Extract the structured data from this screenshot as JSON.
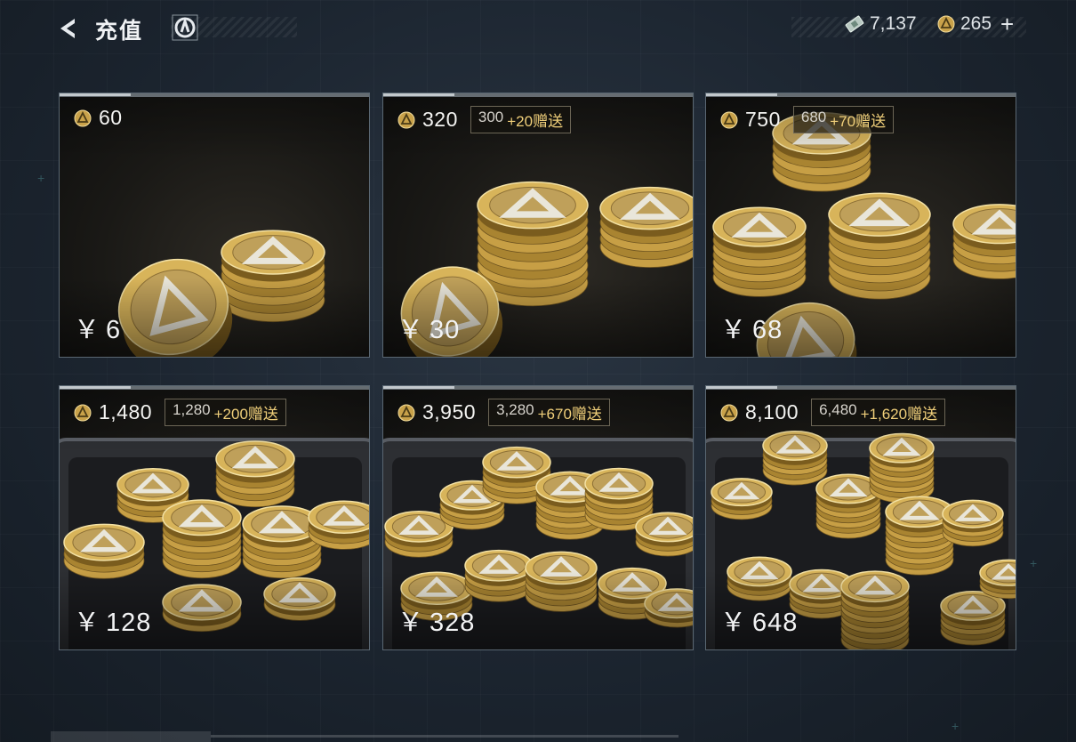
{
  "header": {
    "title": "充值",
    "back_icon": "back-arrow-icon",
    "logo_icon": "game-logo-icon"
  },
  "currency": {
    "ticket_amount": "7,137",
    "coin_amount": "265",
    "add_label": "+"
  },
  "products": [
    {
      "amount": "60",
      "base": "",
      "bonus": "",
      "price": "6",
      "art": "small"
    },
    {
      "amount": "320",
      "base": "300",
      "bonus": "+20赠送",
      "price": "30",
      "art": "small"
    },
    {
      "amount": "750",
      "base": "680",
      "bonus": "+70赠送",
      "price": "68",
      "art": "medium"
    },
    {
      "amount": "1,480",
      "base": "1,280",
      "bonus": "+200赠送",
      "price": "128",
      "art": "chest"
    },
    {
      "amount": "3,950",
      "base": "3,280",
      "bonus": "+670赠送",
      "price": "328",
      "art": "chest"
    },
    {
      "amount": "8,100",
      "base": "6,480",
      "bonus": "+1,620赠送",
      "price": "648",
      "art": "chest"
    }
  ],
  "price_symbol": "￥",
  "colors": {
    "gold": "#f0cf7a",
    "coin": "#c9a24a",
    "background": "#1c2530"
  }
}
